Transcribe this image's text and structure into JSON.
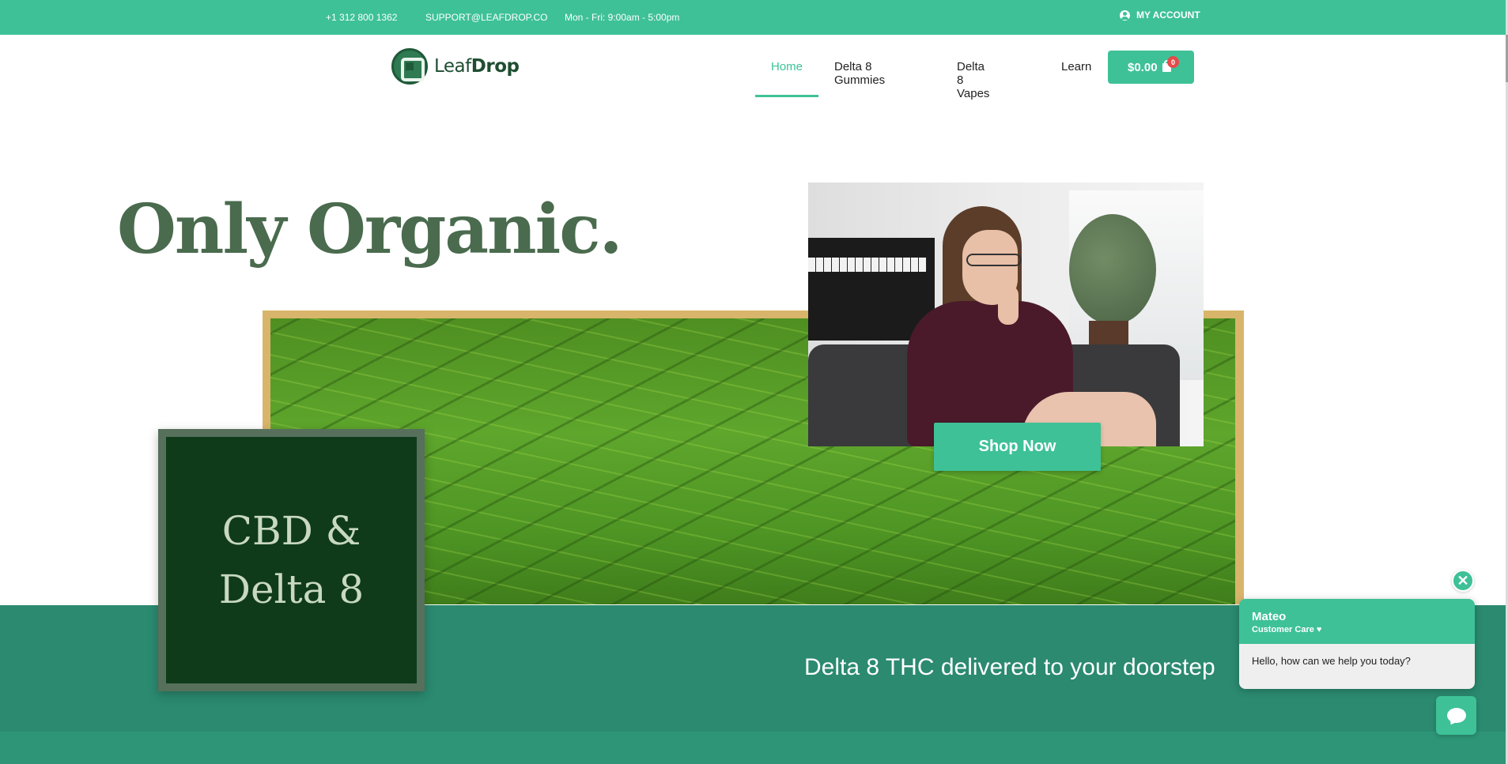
{
  "topbar": {
    "phone": "+1 312 800 1362",
    "email": "SUPPORT@LEAFDROP.CO",
    "hours": "Mon - Fri: 9:00am - 5:00pm",
    "account_label": "MY ACCOUNT",
    "account_icon": "user-circle-icon"
  },
  "header": {
    "logo": {
      "word1": "Leaf",
      "word2": "Drop"
    },
    "nav": [
      {
        "label": "Home",
        "active": true
      },
      {
        "label": "Delta 8 Gummies",
        "active": false
      },
      {
        "label": "Delta 8 Vapes",
        "active": false
      },
      {
        "label": "Learn",
        "active": false
      }
    ],
    "cart": {
      "total": "$0.00",
      "count": "0",
      "icon": "shopping-bag-icon"
    }
  },
  "hero": {
    "headline": "Only Organic.",
    "box_line1": "CBD &",
    "box_line2": "Delta 8",
    "cta": "Shop Now",
    "tagline": "Delta 8 THC delivered to your doorstep"
  },
  "chat": {
    "agent_name": "Mateo",
    "agent_role": "Customer Care ♥",
    "message": "Hello, how can we help you today?",
    "close_icon": "close-icon",
    "launcher_icon": "chat-bubble-icon"
  },
  "colors": {
    "brand_green": "#3ec197",
    "band_green": "#2b8a70",
    "headline_green": "#4a6b4e",
    "gold": "#d8b56a",
    "dark_box": "#0f3b1a"
  }
}
